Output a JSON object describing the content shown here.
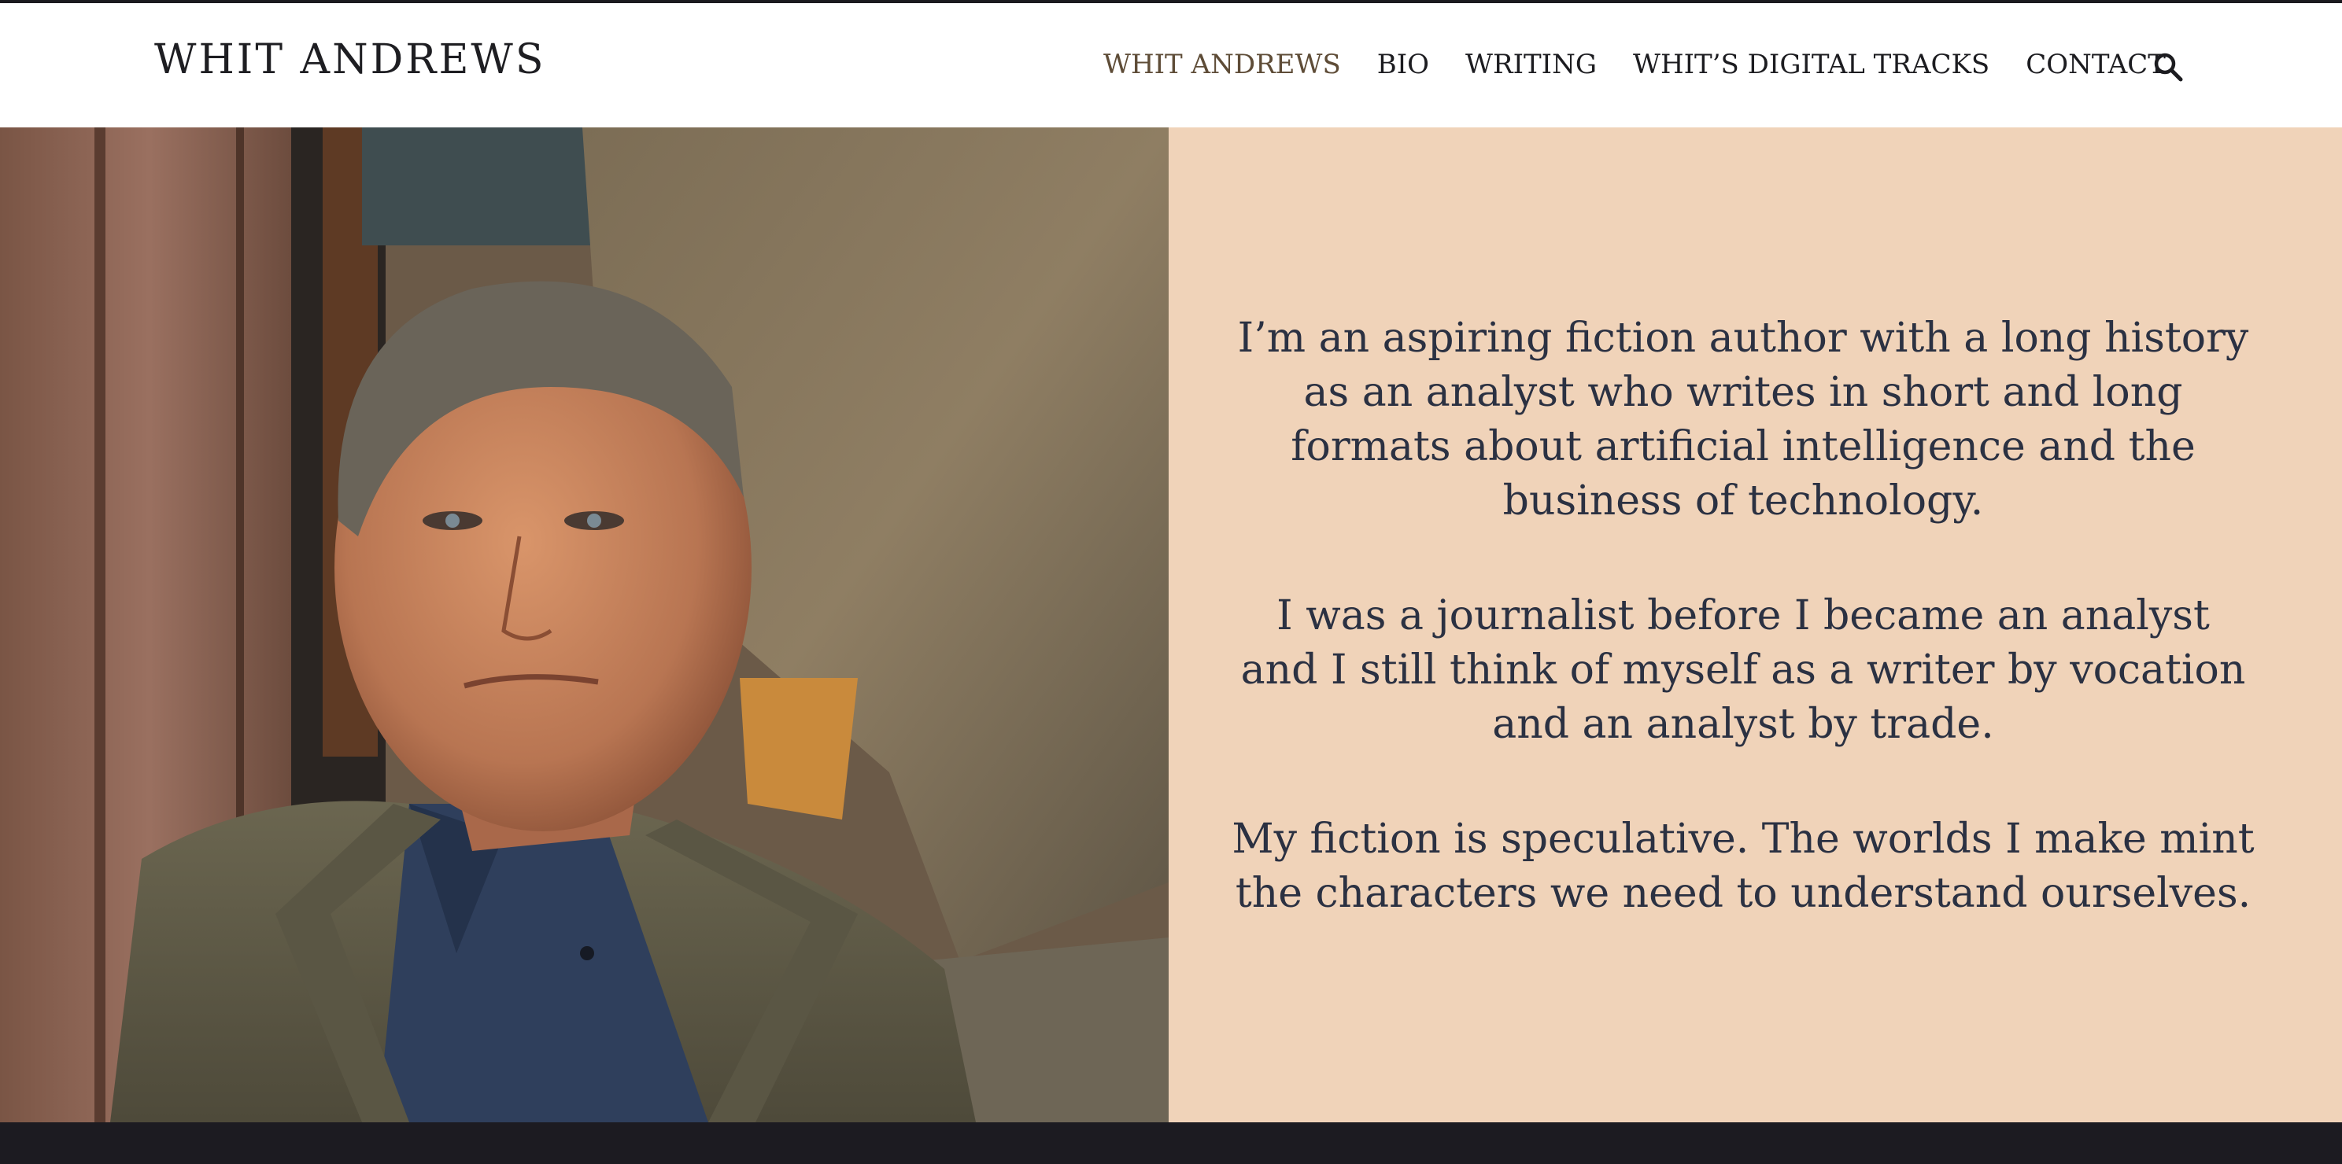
{
  "header": {
    "site_title": "WHIT ANDREWS",
    "nav": [
      {
        "label": "WHIT ANDREWS",
        "active": true
      },
      {
        "label": "BIO",
        "active": false
      },
      {
        "label": "WRITING",
        "active": false
      },
      {
        "label": "WHIT’S DIGITAL TRACKS",
        "active": false
      },
      {
        "label": "CONTACT",
        "active": false
      }
    ],
    "search_icon": "search-icon"
  },
  "hero": {
    "photo_description_icon": "portrait-photo",
    "paragraphs": [
      "I’m an aspiring fiction author with a long history as an analyst who writes in short and long formats about artificial intelligence and the business of technology.",
      "I was a journalist before I became an analyst and I still think of myself as a writer by vocation and an analyst by trade.",
      "My fiction is speculative. The worlds I make mint the characters we need to understand ourselves."
    ]
  },
  "colors": {
    "panel_bg": "#f0d3b9",
    "text": "#2b3142",
    "nav_active": "#5e4c37",
    "footer": "#1c1b21"
  }
}
